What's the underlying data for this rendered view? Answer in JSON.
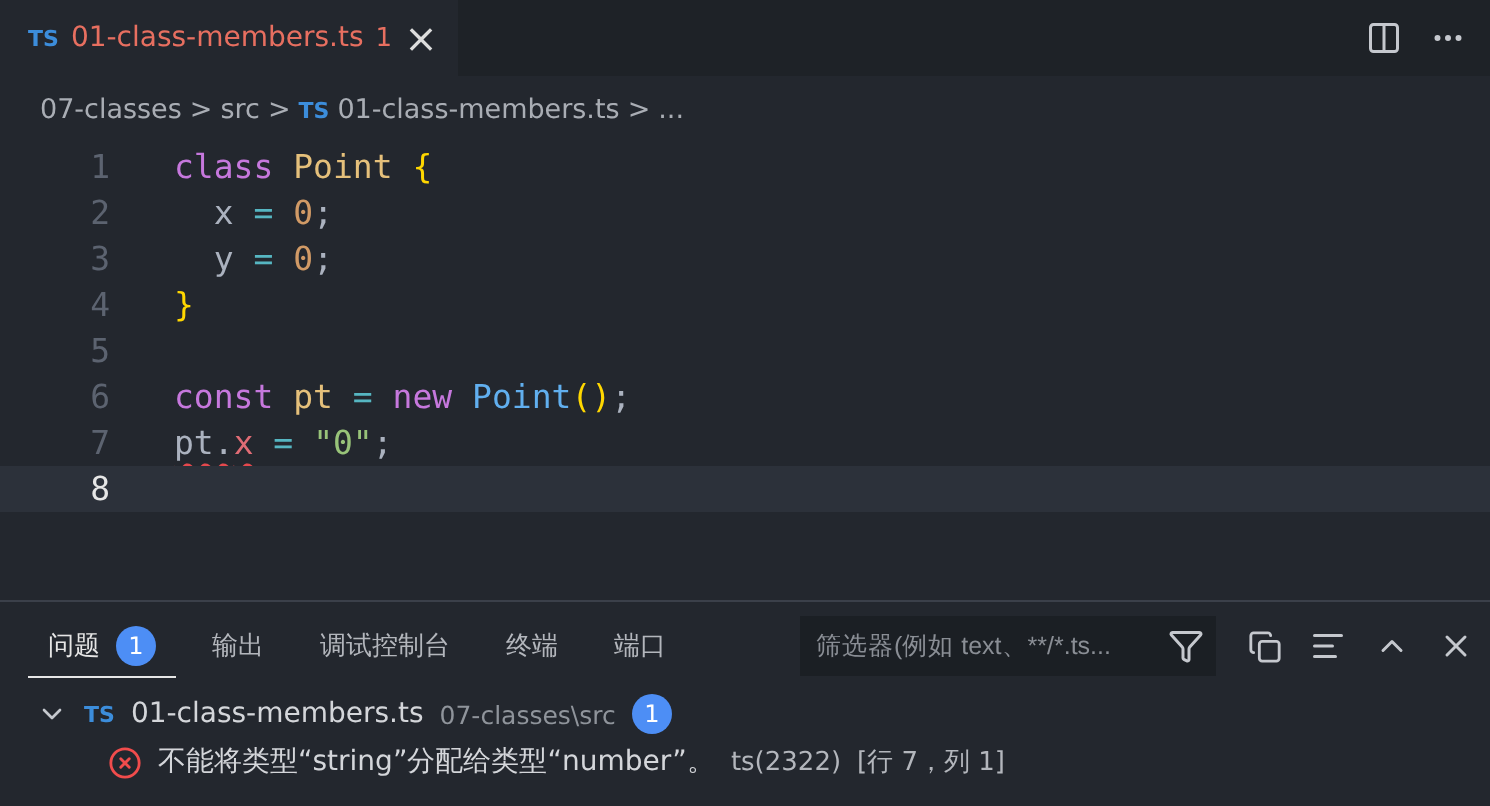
{
  "tabs": [
    {
      "icon_text": "TS",
      "label": "01-class-members.ts",
      "problems": "1",
      "close": "×"
    }
  ],
  "breadcrumb": [
    {
      "label": "07-classes"
    },
    {
      "label": "src"
    },
    {
      "label": "01-class-members.ts",
      "icon_text": "TS"
    },
    {
      "label": "..."
    }
  ],
  "breadcrumb_separator": ">",
  "editor": {
    "lines": [
      {
        "number": "1",
        "current": false,
        "tokens": [
          {
            "text": "class ",
            "kind": "keyword"
          },
          {
            "text": "Point ",
            "kind": "type"
          },
          {
            "text": "{",
            "kind": "bracket"
          }
        ]
      },
      {
        "number": "2",
        "current": false,
        "tokens": [
          {
            "text": "  x",
            "kind": "plain"
          },
          {
            "text": " = ",
            "kind": "operator"
          },
          {
            "text": "0",
            "kind": "number"
          },
          {
            "text": ";",
            "kind": "plain"
          }
        ]
      },
      {
        "number": "3",
        "current": false,
        "tokens": [
          {
            "text": "  y",
            "kind": "plain"
          },
          {
            "text": " = ",
            "kind": "operator"
          },
          {
            "text": "0",
            "kind": "number"
          },
          {
            "text": ";",
            "kind": "plain"
          }
        ]
      },
      {
        "number": "4",
        "current": false,
        "tokens": [
          {
            "text": "}",
            "kind": "bracket"
          }
        ]
      },
      {
        "number": "5",
        "current": false
      },
      {
        "number": "6",
        "current": false,
        "tokens": [
          {
            "text": "const ",
            "kind": "keyword"
          },
          {
            "text": "pt",
            "kind": "variable"
          },
          {
            "text": " = ",
            "kind": "operator"
          },
          {
            "text": "new ",
            "kind": "keyword"
          },
          {
            "text": "Point",
            "kind": "function"
          },
          {
            "text": "()",
            "kind": "bracket"
          },
          {
            "text": ";",
            "kind": "plain"
          }
        ]
      },
      {
        "number": "7",
        "current": false,
        "tokens": [
          {
            "text": "pt.",
            "kind": "plain",
            "squiggle": true
          },
          {
            "text": "x",
            "kind": "property",
            "squiggle": true
          },
          {
            "text": " = ",
            "kind": "operator"
          },
          {
            "text": "\"0\"",
            "kind": "string"
          },
          {
            "text": ";",
            "kind": "plain"
          }
        ]
      },
      {
        "number": "8",
        "current": true
      }
    ]
  },
  "panel": {
    "tabs": [
      {
        "label": "问题",
        "badge": "1",
        "selected": true
      },
      {
        "label": "输出",
        "selected": false
      },
      {
        "label": "调试控制台",
        "selected": false
      },
      {
        "label": "终端",
        "selected": false
      },
      {
        "label": "端口",
        "selected": false
      }
    ],
    "filter": {
      "placeholder": "筛选器(例如 text、**/*.ts..."
    },
    "file": {
      "icon_text": "TS",
      "name": "01-class-members.ts",
      "path": "07-classes\\src",
      "count": "1",
      "expanded": true
    },
    "problems": [
      {
        "message": "不能将类型“string”分配给类型“number”。",
        "code": "ts(2322)",
        "location": "[行 7，列 1]"
      }
    ]
  }
}
